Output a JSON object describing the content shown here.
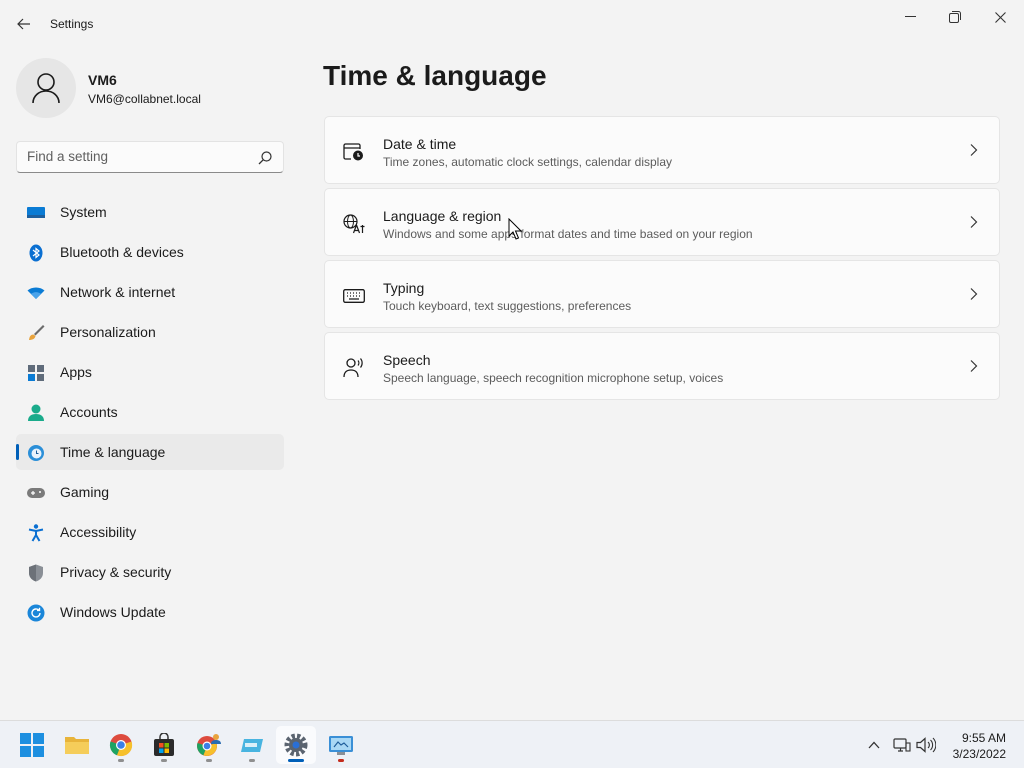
{
  "window": {
    "title": "Settings"
  },
  "profile": {
    "name": "VM6",
    "email": "VM6@collabnet.local"
  },
  "search": {
    "placeholder": "Find a setting"
  },
  "sidebar": {
    "items": [
      {
        "label": "System",
        "icon": "system-icon"
      },
      {
        "label": "Bluetooth & devices",
        "icon": "bluetooth-icon"
      },
      {
        "label": "Network & internet",
        "icon": "wifi-icon"
      },
      {
        "label": "Personalization",
        "icon": "brush-icon"
      },
      {
        "label": "Apps",
        "icon": "apps-icon"
      },
      {
        "label": "Accounts",
        "icon": "accounts-icon"
      },
      {
        "label": "Time & language",
        "icon": "time-language-icon",
        "selected": true
      },
      {
        "label": "Gaming",
        "icon": "gamepad-icon"
      },
      {
        "label": "Accessibility",
        "icon": "accessibility-icon"
      },
      {
        "label": "Privacy & security",
        "icon": "shield-icon"
      },
      {
        "label": "Windows Update",
        "icon": "update-icon"
      }
    ]
  },
  "main": {
    "title": "Time & language",
    "cards": [
      {
        "title": "Date & time",
        "subtitle": "Time zones, automatic clock settings, calendar display",
        "icon": "calendar-clock-icon"
      },
      {
        "title": "Language & region",
        "subtitle": "Windows and some apps format dates and time based on your region",
        "icon": "language-icon"
      },
      {
        "title": "Typing",
        "subtitle": "Touch keyboard, text suggestions, preferences",
        "icon": "keyboard-icon"
      },
      {
        "title": "Speech",
        "subtitle": "Speech language, speech recognition microphone setup, voices",
        "icon": "speech-icon"
      }
    ]
  },
  "taskbar": {
    "apps": [
      "start-icon",
      "file-explorer-icon",
      "chrome-icon",
      "store-icon",
      "chrome-profile-icon",
      "storage-icon",
      "settings-icon",
      "remote-desktop-icon"
    ],
    "time": "9:55 AM",
    "date": "3/23/2022"
  },
  "colors": {
    "accent": "#005fb8",
    "background": "#f3f3f3",
    "card": "#fbfbfb"
  }
}
